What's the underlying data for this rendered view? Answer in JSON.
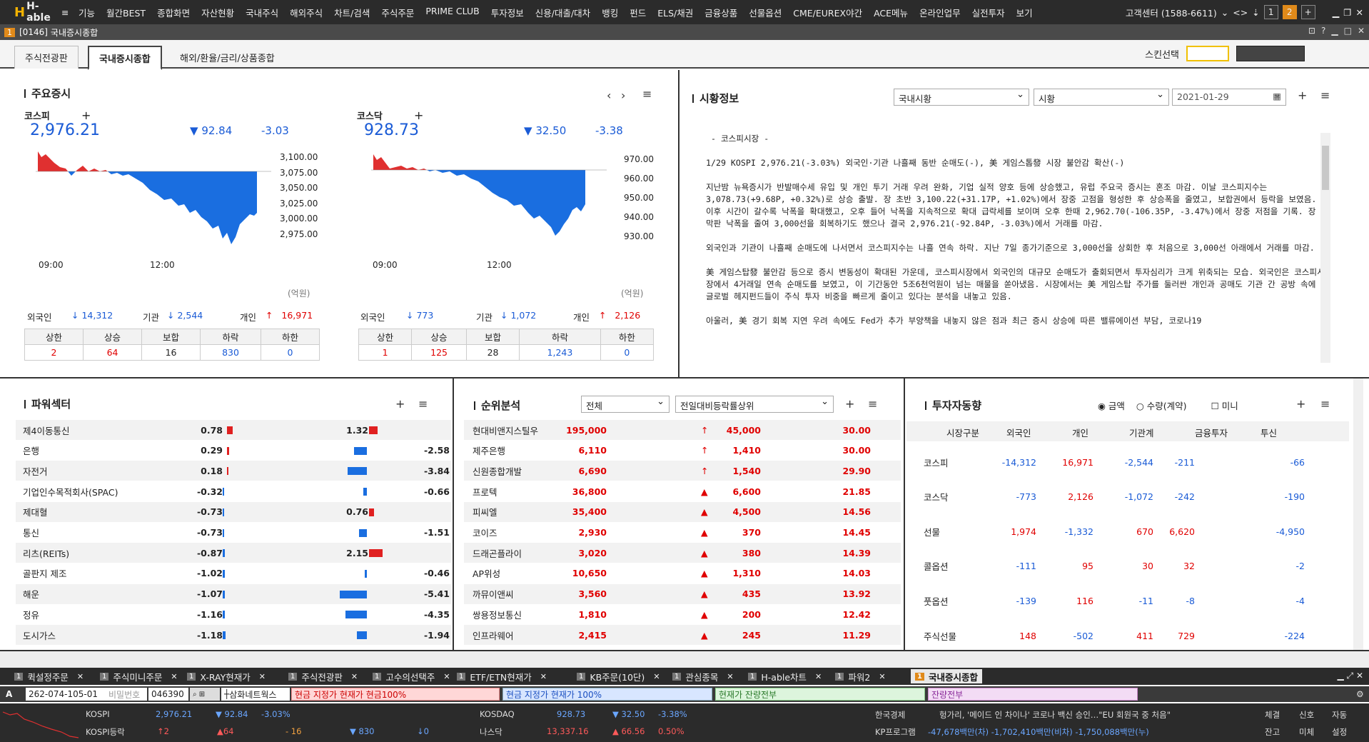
{
  "app": {
    "logo": "H-able",
    "menu": [
      "기능",
      "월간BEST",
      "종합화면",
      "자산현황",
      "국내주식",
      "해외주식",
      "차트/검색",
      "주식주문",
      "PRIME CLUB",
      "투자정보",
      "신용/대출/대차",
      "뱅킹",
      "펀드",
      "ELS/채권",
      "금융상품",
      "선물옵션",
      "CME/EUREX야간",
      "ACE메뉴",
      "온라인업무",
      "실전투자",
      "보기"
    ],
    "customer_center": "고객센터 (1588-6611)",
    "windows": [
      "1",
      "2",
      "+"
    ]
  },
  "window": {
    "screen_no": "1",
    "code": "[0146]",
    "title": "국내증시종합"
  },
  "tabs": [
    "주식전광판",
    "국내증시종합",
    "해외/환율/금리/상품종합"
  ],
  "skin_label": "스킨선택",
  "major": {
    "title": "주요증시",
    "unit": "(억원)",
    "kospi": {
      "name": "코스피",
      "value": "2,976.21",
      "arrow": "▼",
      "change": "92.84",
      "pct": "-3.03",
      "y_ticks": [
        "3,100.00",
        "3,075.00",
        "3,050.00",
        "3,025.00",
        "3,000.00",
        "2,975.00"
      ],
      "x_ticks": [
        "09:00",
        "12:00"
      ],
      "flows": {
        "foreign_label": "외국인",
        "foreign_arrow": "↓",
        "foreign": "14,312",
        "inst_label": "기관",
        "inst_arrow": "↓",
        "inst": "2,544",
        "indiv_label": "개인",
        "indiv_arrow": "↑",
        "indiv": "16,971"
      },
      "counts": {
        "headers": [
          "상한",
          "상승",
          "보합",
          "하락",
          "하한"
        ],
        "values": [
          "2",
          "64",
          "16",
          "830",
          "0"
        ]
      }
    },
    "kosdaq": {
      "name": "코스닥",
      "value": "928.73",
      "arrow": "▼",
      "change": "32.50",
      "pct": "-3.38",
      "y_ticks": [
        "970.00",
        "960.00",
        "950.00",
        "940.00",
        "930.00"
      ],
      "x_ticks": [
        "09:00",
        "12:00"
      ],
      "flows": {
        "foreign_label": "외국인",
        "foreign_arrow": "↓",
        "foreign": "773",
        "inst_label": "기관",
        "inst_arrow": "↓",
        "inst": "1,072",
        "indiv_label": "개인",
        "indiv_arrow": "↑",
        "indiv": "2,126"
      },
      "counts": {
        "headers": [
          "상한",
          "상승",
          "보합",
          "하락",
          "하한"
        ],
        "values": [
          "1",
          "125",
          "28",
          "1,243",
          "0"
        ]
      }
    }
  },
  "market_info": {
    "title": "시황정보",
    "sel1": "국내시황",
    "sel2": "시황",
    "date": "2021-01-29",
    "text": " - 코스피시장 -\n\n1/29 KOSPI 2,976.21(-3.03%) 외국인·기관 나흘째 동반 순매도(-), 美 게임스톱發 시장 불안감 확산(-)\n\n지난밤 뉴욕증시가 반발매수세 유입 및 개인 투기 거래 우려 완화, 기업 실적 양호 등에 상승했고, 유럽 주요국 증시는 혼조 마감. 이날 코스피지수는 3,078.73(+9.68P, +0.32%)로 상승 출발. 장 초반 3,100.22(+31.17P, +1.02%)에서 장중 고점을 형성한 후 상승폭을 줄였고, 보합권에서 등락을 보였음. 이후 시간이 갈수록 낙폭을 확대했고, 오후 들어 낙폭을 지속적으로 확대 급락세를 보이며 오후 한때 2,962.70(-106.35P, -3.47%)에서 장중 저점을 기록. 장 막판 낙폭을 줄여 3,000선을 회복하기도 했으나 결국 2,976.21(-92.84P, -3.03%)에서 거래를 마감.\n\n외국인과 기관이 나흘째 순매도에 나서면서 코스피지수는 나흘 연속 하락. 지난 7일 종가기준으로 3,000선을 상회한 후 처음으로 3,000선 아래에서 거래를 마감.\n\n美 게임스탑發 불안감 등으로 증시 변동성이 확대된 가운데, 코스피시장에서 외국인의 대규모 순매도가 출회되면서 투자심리가 크게 위축되는 모습. 외국인은 코스피시장에서 4거래일 연속 순매도를 보였고, 이 기간동안 5조6천억원이 넘는 매물을 쏟아냈음. 시장에서는 美 게임스탑 주가를 둘러싼 개인과 공매도 기관 간 공방 속에 글로벌 헤지펀드들이 주식 투자 비중을 빠르게 줄이고 있다는 분석을 내놓고 있음.\n\n아울러, 美 경기 회복 지연 우려 속에도 Fed가 추가 부양책을 내놓지 않은 점과 최근 증시 상승에 따른 밸류에이션 부담, 코로나19"
  },
  "power_sector": {
    "title": "파워섹터",
    "rows": [
      {
        "name": "제4이동통신",
        "a": "0.78",
        "b": "1.32",
        "c": ""
      },
      {
        "name": "은행",
        "a": "0.29",
        "b": "",
        "c": "-2.58"
      },
      {
        "name": "자전거",
        "a": "0.18",
        "b": "",
        "c": "-3.84"
      },
      {
        "name": "기업인수목적회사(SPAC)",
        "a": "-0.32",
        "b": "",
        "c": "-0.66"
      },
      {
        "name": "제대혈",
        "a": "-0.73",
        "b": "0.76",
        "c": ""
      },
      {
        "name": "통신",
        "a": "-0.73",
        "b": "",
        "c": "-1.51"
      },
      {
        "name": "리츠(REITs)",
        "a": "-0.87",
        "b": "2.15",
        "c": ""
      },
      {
        "name": "골판지 제조",
        "a": "-1.02",
        "b": "",
        "c": "-0.46"
      },
      {
        "name": "해운",
        "a": "-1.07",
        "b": "",
        "c": "-5.41"
      },
      {
        "name": "정유",
        "a": "-1.16",
        "b": "",
        "c": "-4.35"
      },
      {
        "name": "도시가스",
        "a": "-1.18",
        "b": "",
        "c": "-1.94"
      }
    ]
  },
  "ranking": {
    "title": "순위분석",
    "sel1": "전체",
    "sel2": "전일대비등락률상위",
    "rows": [
      {
        "name": "현대비앤지스틸우",
        "price": "195,000",
        "arrow": "↑",
        "chg": "45,000",
        "pct": "30.00"
      },
      {
        "name": "제주은행",
        "price": "6,110",
        "arrow": "↑",
        "chg": "1,410",
        "pct": "30.00"
      },
      {
        "name": "신원종합개발",
        "price": "6,690",
        "arrow": "↑",
        "chg": "1,540",
        "pct": "29.90"
      },
      {
        "name": "프로텍",
        "price": "36,800",
        "arrow": "▲",
        "chg": "6,600",
        "pct": "21.85"
      },
      {
        "name": "피씨엘",
        "price": "35,400",
        "arrow": "▲",
        "chg": "4,500",
        "pct": "14.56"
      },
      {
        "name": "코이즈",
        "price": "2,930",
        "arrow": "▲",
        "chg": "370",
        "pct": "14.45"
      },
      {
        "name": "드래곤플라이",
        "price": "3,020",
        "arrow": "▲",
        "chg": "380",
        "pct": "14.39"
      },
      {
        "name": "AP위성",
        "price": "10,650",
        "arrow": "▲",
        "chg": "1,310",
        "pct": "14.03"
      },
      {
        "name": "까뮤이앤씨",
        "price": "3,560",
        "arrow": "▲",
        "chg": "435",
        "pct": "13.92"
      },
      {
        "name": "쌍용정보통신",
        "price": "1,810",
        "arrow": "▲",
        "chg": "200",
        "pct": "12.42"
      },
      {
        "name": "인프라웨어",
        "price": "2,415",
        "arrow": "▲",
        "chg": "245",
        "pct": "11.29"
      }
    ]
  },
  "investor": {
    "title": "투자자동향",
    "opt1": "금액",
    "opt2": "수량(계약)",
    "opt3": "미니",
    "headers": [
      "시장구분",
      "외국인",
      "개인",
      "기관계",
      "금융투자",
      "투신"
    ],
    "rows": [
      {
        "name": "코스피",
        "v": [
          "-14,312",
          "16,971",
          "-2,544",
          "-211",
          "-66"
        ]
      },
      {
        "name": "코스닥",
        "v": [
          "-773",
          "2,126",
          "-1,072",
          "-242",
          "-190"
        ]
      },
      {
        "name": "선물",
        "v": [
          "1,974",
          "-1,332",
          "670",
          "6,620",
          "-4,950"
        ]
      },
      {
        "name": "콜옵션",
        "v": [
          "-111",
          "95",
          "30",
          "32",
          "-2"
        ]
      },
      {
        "name": "풋옵션",
        "v": [
          "-139",
          "116",
          "-11",
          "-8",
          "-4"
        ]
      },
      {
        "name": "주식선물",
        "v": [
          "148",
          "-502",
          "411",
          "729",
          "-224"
        ]
      }
    ]
  },
  "bottom_tabs": [
    {
      "n": "1",
      "label": "퀵설정주문"
    },
    {
      "n": "1",
      "label": "주식미니주문"
    },
    {
      "n": "1",
      "label": "X-RAY현재가"
    },
    {
      "n": "1",
      "label": "주식전광판"
    },
    {
      "n": "1",
      "label": "고수의선택주"
    },
    {
      "n": "1",
      "label": "ETF/ETN현재가"
    },
    {
      "n": "1",
      "label": "KB주문(10단)"
    },
    {
      "n": "1",
      "label": "관심종목"
    },
    {
      "n": "1",
      "label": "H-able차트"
    },
    {
      "n": "1",
      "label": "파워2"
    },
    {
      "n": "1",
      "label": "국내증시종합"
    }
  ],
  "order": {
    "account": "262-074-105-01",
    "pw_placeholder": "비밀번호",
    "code": "046390",
    "stock": "삼화네트웍스",
    "b1": "현금 지정가 현재가 현금100%",
    "b2": "현금 지정가 현재가 100%",
    "b3": "현재가 잔량전부",
    "b4": "잔량전부"
  },
  "ticker": {
    "l1": {
      "name": "KOSPI",
      "val": "2,976.21",
      "chg": "▼ 92.84",
      "pct": "-3.03%",
      "name2": "KOSDAQ",
      "val2": "928.73",
      "chg2": "▼ 32.50",
      "pct2": "-3.38%",
      "news_label": "한국경제",
      "news": "헝가리, '메이드 인 차이나' 코로나 백신 승인…\"EU 회원국 중 처음\""
    },
    "l2": {
      "name": "KOSPI등락",
      "up": "↑2",
      "up2": "▲64",
      "flat": "- 16",
      "dn": "▼ 830",
      "dn2": "↓0",
      "name2": "나스닥",
      "val2": "13,337.16",
      "chg2": "▲ 66.56",
      "pct2": "0.50%",
      "prog_label": "KP프로그램",
      "prog": "-47,678백만(차) -1,702,410백만(비차) -1,750,088백만(누)"
    },
    "right": [
      "체결",
      "신호",
      "자동",
      "잔고",
      "미체",
      "설정"
    ]
  }
}
